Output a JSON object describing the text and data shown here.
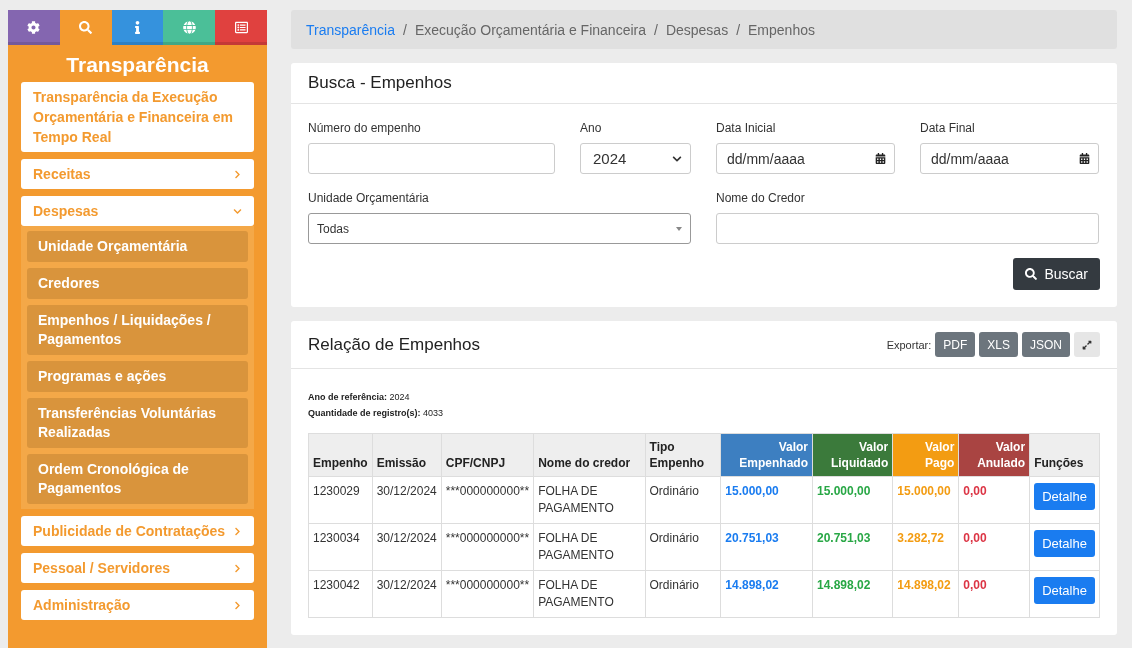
{
  "sidebar": {
    "tabs": [
      {
        "color": "#8466b0",
        "selected": false
      },
      {
        "color": "#f39a2f",
        "selected": true
      },
      {
        "color": "#3592dd",
        "selected": false
      },
      {
        "color": "#4bbf98",
        "selected": false
      },
      {
        "color": "#e0413f",
        "selected": false
      }
    ],
    "title": "Transparência",
    "items": [
      {
        "label": "Transparência da Execução Orçamentária e Financeira em Tempo Real",
        "kind": "link"
      },
      {
        "label": "Receitas",
        "kind": "menu",
        "expanded": false
      },
      {
        "label": "Despesas",
        "kind": "menu",
        "expanded": true,
        "children": [
          {
            "label": "Unidade Orçamentária"
          },
          {
            "label": "Credores"
          },
          {
            "label": "Empenhos / Liquidações / Pagamentos"
          },
          {
            "label": "Programas e ações"
          },
          {
            "label": "Transferências Voluntárias Realizadas"
          },
          {
            "label": "Ordem Cronológica de Pagamentos"
          }
        ]
      },
      {
        "label": "Publicidade de Contratações",
        "kind": "menu",
        "expanded": false
      },
      {
        "label": "Pessoal / Servidores",
        "kind": "menu",
        "expanded": false
      },
      {
        "label": "Administração",
        "kind": "menu",
        "expanded": false
      }
    ]
  },
  "breadcrumb": [
    {
      "kind": "link",
      "label": "Transparência"
    },
    {
      "kind": "separator",
      "label": "/"
    },
    {
      "kind": "text",
      "label": "Execução Orçamentária e Financeira"
    },
    {
      "kind": "separator",
      "label": "/"
    },
    {
      "kind": "text",
      "label": "Despesas"
    },
    {
      "kind": "separator",
      "label": "/"
    },
    {
      "kind": "text",
      "label": "Empenhos"
    }
  ],
  "search": {
    "title": "Busca - Empenhos",
    "fields": [
      {
        "label": "Número do empenho",
        "kind": "text"
      },
      {
        "label": "Ano",
        "kind": "select",
        "value": "2024"
      },
      {
        "label": "Data Inicial",
        "kind": "date",
        "placeholder": "dd/mm/aaaa"
      },
      {
        "label": "Data Final",
        "kind": "date",
        "placeholder": "dd/mm/aaaa"
      },
      {
        "label": "Unidade Orçamentária",
        "kind": "combo",
        "value": "Todas"
      },
      {
        "label": "Nome do Credor",
        "kind": "text"
      }
    ],
    "button": "Buscar"
  },
  "results": {
    "title": "Relação de Empenhos",
    "export_label": "Exportar:",
    "export_buttons": [
      "PDF",
      "XLS",
      "JSON"
    ],
    "info": [
      "**Ano de referência:** 2024",
      "**Quantidade de registro(s):** 4033"
    ],
    "columns": [
      {
        "label": "Empenho"
      },
      {
        "label": "Emissão"
      },
      {
        "label": "CPF/CNPJ"
      },
      {
        "label": "Nome do credor"
      },
      {
        "label": "Tipo Empenho"
      },
      {
        "label": "Valor Empenhado",
        "color": "#3d7fc1"
      },
      {
        "label": "Valor Liquidado",
        "color": "#3b7a3b"
      },
      {
        "label": "Valor Pago",
        "color": "#f39c12"
      },
      {
        "label": "Valor Anulado",
        "color": "#a94442"
      },
      {
        "label": "Funções"
      }
    ],
    "rows": [
      [
        "1230029",
        "30/12/2024",
        "***000000000**",
        "FOLHA DE PAGAMENTO",
        "Ordinário",
        "15.000,00",
        "15.000,00",
        "15.000,00",
        "0,00",
        "Detalhe"
      ],
      [
        "1230034",
        "30/12/2024",
        "***000000000**",
        "FOLHA DE PAGAMENTO",
        "Ordinário",
        "20.751,03",
        "20.751,03",
        "3.282,72",
        "0,00",
        "Detalhe"
      ],
      [
        "1230042",
        "30/12/2024",
        "***000000000**",
        "FOLHA DE PAGAMENTO",
        "Ordinário",
        "14.898,02",
        "14.898,02",
        "14.898,02",
        "0,00",
        "Detalhe"
      ]
    ]
  }
}
